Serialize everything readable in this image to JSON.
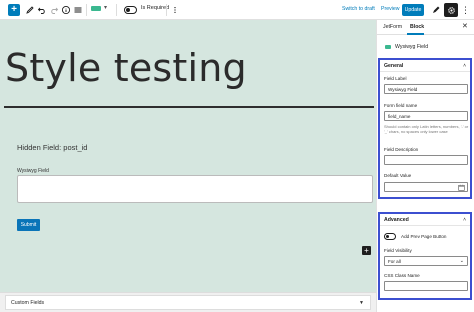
{
  "toolbar": {
    "add_label": "+",
    "is_required_label": "Is Required",
    "switch_to_draft_label": "Switch to draft",
    "preview_label": "Preview",
    "update_label": "Update",
    "field_color": "#3bb890"
  },
  "canvas": {
    "title": "Style testing",
    "hidden_field": "Hidden Field: post_id",
    "wysiwyg_label": "Wysiwyg Field",
    "submit_label": "Submit",
    "add_block_label": "+"
  },
  "metabox": {
    "custom_fields_label": "Custom Fields"
  },
  "sidebar": {
    "tabs": [
      {
        "label": "JetForm",
        "active": false
      },
      {
        "label": "Block",
        "active": true
      }
    ],
    "close_label": "✕",
    "block_name": "Wysiwyg Field",
    "general": {
      "title": "General",
      "field_label_label": "Field Label",
      "field_label_value": "Wysiwyg Field",
      "field_name_label": "Form field name",
      "field_name_value": "field_name",
      "field_name_help": "Should contain only Latin letters, numbers, '-' or '_' chars, no spaces only lower case",
      "description_label": "Field Description",
      "description_value": "",
      "default_label": "Default Value",
      "default_value": ""
    },
    "advanced": {
      "title": "Advanced",
      "prev_page_label": "Add Prev Page Button",
      "visibility_label": "Field Visibility",
      "visibility_value": "For all",
      "css_label": "CSS Class Name",
      "css_value": ""
    }
  },
  "colors": {
    "accent": "#007cba",
    "highlight_border": "#3c4fd0",
    "canvas_bg": "#d5e6df"
  }
}
